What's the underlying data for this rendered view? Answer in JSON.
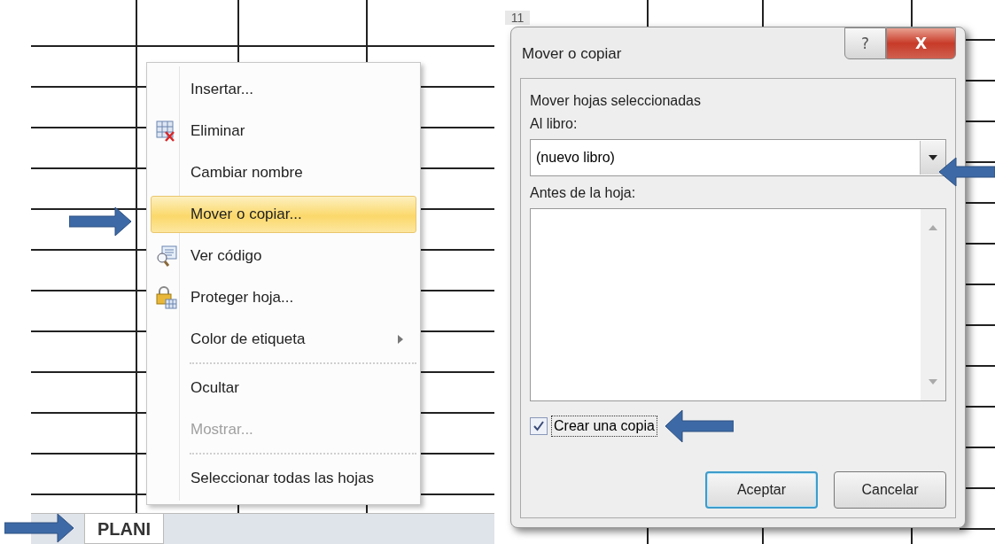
{
  "sheet": {
    "tabs": [
      {
        "label": "PLANI",
        "selected": true
      }
    ]
  },
  "context_menu": {
    "groups": [
      [
        {
          "label": "Insertar...",
          "selected": false,
          "disabled": false,
          "submenu": false
        },
        {
          "label": "Eliminar",
          "selected": false,
          "disabled": false,
          "submenu": false
        },
        {
          "label": "Cambiar nombre",
          "selected": false,
          "disabled": false,
          "submenu": false
        },
        {
          "label": "Mover o copiar...",
          "selected": true,
          "disabled": false,
          "submenu": false
        },
        {
          "label": "Ver código",
          "selected": false,
          "disabled": false,
          "submenu": false
        },
        {
          "label": "Proteger hoja...",
          "selected": false,
          "disabled": false,
          "submenu": false
        },
        {
          "label": "Color de etiqueta",
          "selected": false,
          "disabled": false,
          "submenu": true
        }
      ],
      [
        {
          "label": "Ocultar",
          "selected": false,
          "disabled": false,
          "submenu": false
        },
        {
          "label": "Mostrar...",
          "selected": false,
          "disabled": true,
          "submenu": false
        }
      ],
      [
        {
          "label": "Seleccionar todas las hojas",
          "selected": false,
          "disabled": false,
          "submenu": false
        }
      ]
    ]
  },
  "row_header": "11",
  "dialog": {
    "title": "Mover o copiar",
    "help_button": "?",
    "close_button": "X",
    "section_label": "Mover hojas seleccionadas",
    "to_book_label": "Al libro:",
    "to_book": {
      "value": "(nuevo libro)"
    },
    "before_sheet_label": "Antes de la hoja:",
    "create_copy": {
      "label": "Crear una copia",
      "checked": true
    },
    "buttons": [
      {
        "label": "Aceptar",
        "default": true
      },
      {
        "label": "Cancelar",
        "default": false
      }
    ]
  }
}
